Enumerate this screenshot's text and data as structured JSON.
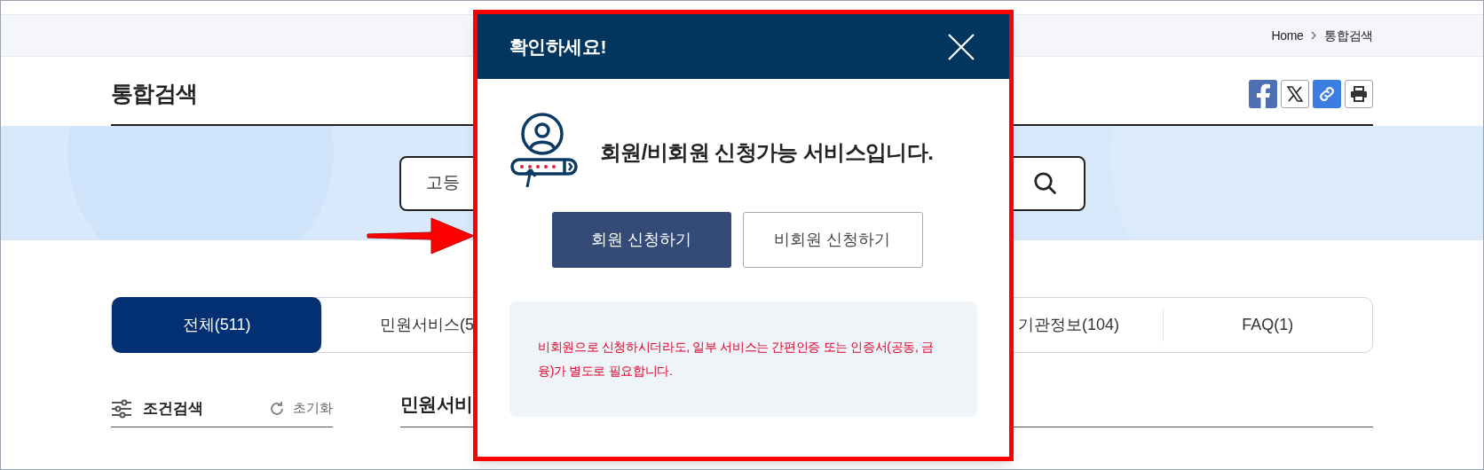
{
  "breadcrumb": [
    "Home",
    "통합검색"
  ],
  "page_title": "통합검색",
  "share_buttons": [
    {
      "kind": "facebook"
    },
    {
      "kind": "x"
    },
    {
      "kind": "link"
    },
    {
      "kind": "print"
    }
  ],
  "search": {
    "value": "고등"
  },
  "tabs": [
    {
      "label": "전체(511)",
      "selected": true
    },
    {
      "label": "민원서비스(5",
      "selected": false
    },
    {
      "label": "기관정보(104)",
      "selected": false
    },
    {
      "label": "FAQ(1)",
      "selected": false
    }
  ],
  "filter": {
    "title": "조건검색",
    "reset": "초기화"
  },
  "section_heading": "민원서비",
  "modal": {
    "title": "확인하세요!",
    "message": "회원/비회원 신청가능 서비스입니다.",
    "buttons": [
      {
        "label": "회원 신청하기",
        "kind": "primary"
      },
      {
        "label": "비회원 신청하기",
        "kind": "secondary"
      }
    ],
    "notice": "비회원으로 신청하시더라도, 일부 서비스는 간편인증 또는 인증서(공동, 금융)가 별도로 필요합니다."
  }
}
